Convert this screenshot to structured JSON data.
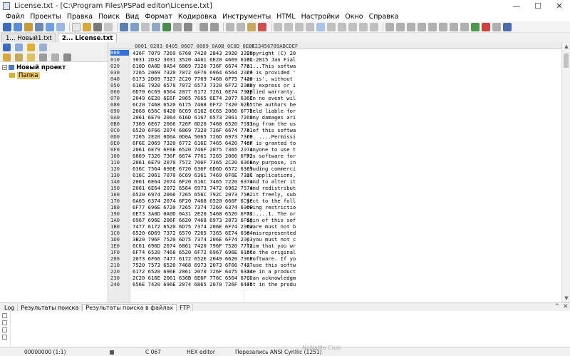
{
  "window": {
    "title": "License.txt - [C:\\Program Files\\PSPad editor\\License.txt]",
    "minimize": "—",
    "maximize": "☐",
    "close": "✕"
  },
  "menu": [
    "Файл",
    "Проекты",
    "Правка",
    "Поиск",
    "Вид",
    "Формат",
    "Кодировка",
    "Инструменты",
    "HTML",
    "Настройки",
    "Окно",
    "Справка"
  ],
  "file_tabs": [
    {
      "label": "1... Новый1.txt",
      "active": false
    },
    {
      "label": "2... License.txt",
      "active": true
    }
  ],
  "project_tree": {
    "root": "Новый проект",
    "child": "Папка"
  },
  "hex": {
    "header_hex": "0001 0203 0405 0607 0809 0A0B 0C0D 0E0F",
    "header_ascii": "0123456789ABCDEF",
    "caret_offset": "000",
    "rows": [
      {
        "off": "000",
        "hex": "436F 7079 7269 6768 7420 2843 2920 3230",
        "ascii": "Copyright (C) 20"
      },
      {
        "off": "010",
        "hex": "3031 2D32 3031 3520 4A61 6E20 4669 616C",
        "ascii": "01-2015 Jan Fial"
      },
      {
        "off": "020",
        "hex": "610D 0A0D 0A54 6869 7320 736F 6674 7761",
        "ascii": "a....This softwa"
      },
      {
        "off": "030",
        "hex": "7265 2069 7320 7072 6F76 6964 6564 2027",
        "ascii": "re is provided '"
      },
      {
        "off": "040",
        "hex": "6173 2D69 7327 2C20 7769 7468 6F75 7420",
        "ascii": "as-is', without "
      },
      {
        "off": "050",
        "hex": "616E 7920 6578 7072 6573 7320 6F72 2069",
        "ascii": "any express or i"
      },
      {
        "off": "060",
        "hex": "6D70 6C69 6564 2077 6172 7261 6E74 792E",
        "ascii": "mplied warranty."
      },
      {
        "off": "070",
        "hex": "2049 6E20 6E6F 2065 7665 6E74 2077 696C",
        "ascii": " In no event wil"
      },
      {
        "off": "080",
        "hex": "6C20 7468 6520 6175 7468 6F72 7320 6265",
        "ascii": "l the authors be"
      },
      {
        "off": "090",
        "hex": "2068 656C 6420 6C69 6162 6C65 2066 6F72",
        "ascii": " held liable for"
      },
      {
        "off": "0A0",
        "hex": "2061 6E79 2064 616D 6167 6573 2061 7269",
        "ascii": " any damages ari"
      },
      {
        "off": "0B0",
        "hex": "7369 6E67 2066 726F 6D20 7468 6520 7573",
        "ascii": "sing from the us"
      },
      {
        "off": "0C0",
        "hex": "6520 6F66 2074 6869 7320 736F 6674 7761",
        "ascii": "e of this softwa"
      },
      {
        "off": "0D0",
        "hex": "7265 2E20 0D0A 0D0A 5065 726D 6973 7369",
        "ascii": "re. ....Permissi"
      },
      {
        "off": "0E0",
        "hex": "6F6E 2069 7320 6772 616E 7465 6420 746F",
        "ascii": "on is granted to"
      },
      {
        "off": "0F0",
        "hex": "2061 6E79 6F6E 6520 746F 2075 7365 2074",
        "ascii": " anyone to use t"
      },
      {
        "off": "100",
        "hex": "6869 7320 736F 6674 7761 7265 2066 6F72",
        "ascii": "his software for"
      },
      {
        "off": "110",
        "hex": "2061 6E79 2070 7572 706F 7365 2C20 696E",
        "ascii": " any purpose, in"
      },
      {
        "off": "120",
        "hex": "636C 7564 696E 6720 636F 6D6D 6572 6369",
        "ascii": "cluding commerci"
      },
      {
        "off": "130",
        "hex": "616C 2061 7070 6C69 6361 7469 6F6E 732C",
        "ascii": "al applications,"
      },
      {
        "off": "140",
        "hex": "2061 6E64 2074 6F20 616C 7465 7220 6974",
        "ascii": " and to alter it"
      },
      {
        "off": "150",
        "hex": "2061 6E64 2072 6564 6973 7472 6962 7574",
        "ascii": " and redistribut"
      },
      {
        "off": "160",
        "hex": "6520 6974 2066 7265 656C 792C 2073 7562",
        "ascii": "e it freely, sub"
      },
      {
        "off": "170",
        "hex": "6A65 6374 2074 6F20 7468 6520 666F 6C6C",
        "ascii": "ject to the foll"
      },
      {
        "off": "180",
        "hex": "6F77 696E 6720 7265 7374 7269 6374 696F",
        "ascii": "owing restrictio"
      },
      {
        "off": "190",
        "hex": "6E73 3A0D 0A0D 0A31 2E20 5468 6520 6F72",
        "ascii": "ns:....1. The or"
      },
      {
        "off": "1A0",
        "hex": "6967 696E 206F 6620 7468 6973 2073 6F66",
        "ascii": "igin of this sof"
      },
      {
        "off": "1B0",
        "hex": "7477 6172 6520 6D75 7374 206E 6F74 2062",
        "ascii": "tware must not b"
      },
      {
        "off": "1C0",
        "hex": "6520 6D69 7372 6570 7265 7365 6E74 6564",
        "ascii": "e misrepresented"
      },
      {
        "off": "1D0",
        "hex": "3B20 796F 7520 6D75 7374 206E 6F74 2063",
        "ascii": "; you must not c"
      },
      {
        "off": "1E0",
        "hex": "6C61 696D 2074 6861 7420 796F 7520 7772",
        "ascii": "laim that you wr"
      },
      {
        "off": "1F0",
        "hex": "6F74 6520 7468 6520 6F72 6967 696E 616C",
        "ascii": "ote the original"
      },
      {
        "off": "200",
        "hex": "2073 6F66 7477 6172 652E 2049 6620 796F",
        "ascii": " software. If yo"
      },
      {
        "off": "210",
        "hex": "7520 7573 6520 7468 6973 2073 6F66 7477",
        "ascii": "u use this softw"
      },
      {
        "off": "220",
        "hex": "6172 6520 696E 2061 2070 726F 6475 6374",
        "ascii": "are in a product"
      },
      {
        "off": "230",
        "hex": "2C20 616E 2061 636B 6E6F 776C 6564 676D",
        "ascii": ", an acknowledgm"
      },
      {
        "off": "240",
        "hex": "656E 7420 696E 2074 6865 2070 726F 6475",
        "ascii": "ent in the produ"
      }
    ]
  },
  "bottom_tabs": [
    "Log",
    "Результаты поиска",
    "Результаты поиска в файлах",
    "FTP"
  ],
  "bottom_active": 2,
  "status": {
    "position": "00000000 (1:1)",
    "char": "C  067",
    "mode": "HEX editor",
    "encoding": "Перезапись  ANSI Cyrillic (1251)"
  },
  "watermark": "NoNaMe Club",
  "colors": {
    "selection": "#3072d6",
    "tree_selected": "#e9c96b"
  }
}
